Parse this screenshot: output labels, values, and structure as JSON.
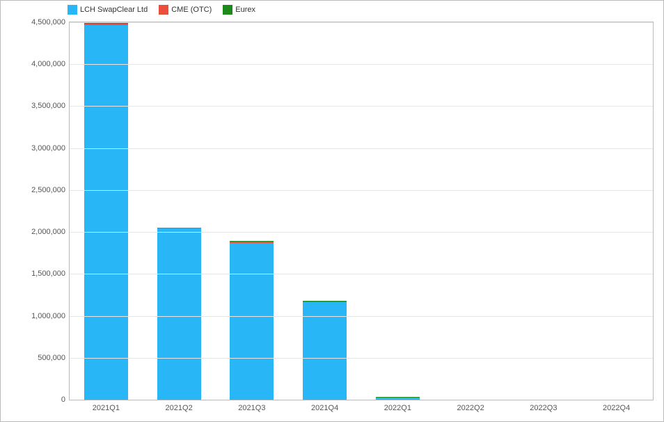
{
  "chart_data": {
    "type": "bar",
    "stacked": true,
    "categories": [
      "2021Q1",
      "2021Q2",
      "2021Q3",
      "2021Q4",
      "2022Q1",
      "2022Q2",
      "2022Q3",
      "2022Q4"
    ],
    "series": [
      {
        "name": "LCH SwapClear Ltd",
        "color": "#29B6F6",
        "values": [
          4470000,
          2040000,
          1870000,
          1165000,
          25000,
          0,
          0,
          0
        ]
      },
      {
        "name": "CME (OTC)",
        "color": "#E94F3B",
        "values": [
          15000,
          12000,
          18000,
          10000,
          3000,
          0,
          0,
          0
        ]
      },
      {
        "name": "Eurex",
        "color": "#1B8A1B",
        "values": [
          5000,
          3000,
          6000,
          3000,
          2000,
          0,
          0,
          0
        ]
      }
    ],
    "ylim": [
      0,
      4500000
    ],
    "yticks": [
      0,
      500000,
      1000000,
      1500000,
      2000000,
      2500000,
      3000000,
      3500000,
      4000000,
      4500000
    ],
    "ytick_labels": [
      "0",
      "500,000",
      "1,000,000",
      "1,500,000",
      "2,000,000",
      "2,500,000",
      "3,000,000",
      "3,500,000",
      "4,000,000",
      "4,500,000"
    ],
    "title": "",
    "xlabel": "",
    "ylabel": "",
    "legend_position": "top-left"
  }
}
